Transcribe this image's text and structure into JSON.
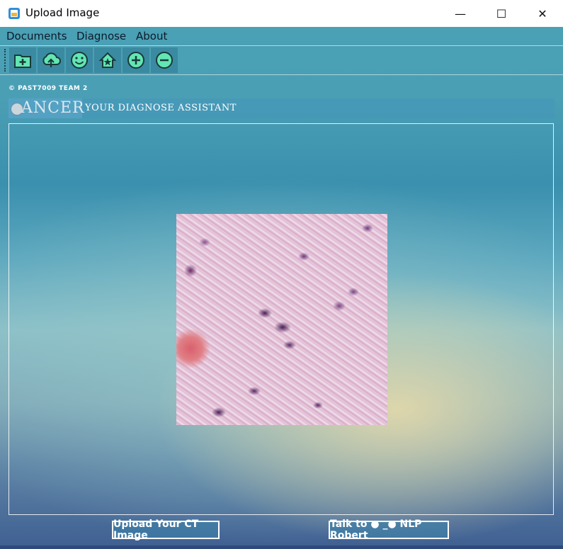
{
  "window": {
    "title": "Upload Image",
    "minimize_glyph": "—",
    "maximize_glyph": "☐",
    "close_glyph": "✕"
  },
  "menu": [
    "Documents",
    "Diagnose",
    "About"
  ],
  "toolbar": {
    "buttons": [
      {
        "name": "new-folder-icon",
        "color": "#1a3a3a",
        "fill": "#63e6b3"
      },
      {
        "name": "upload-cloud-icon",
        "color": "#1a3a3a",
        "fill": "#63e6b3"
      },
      {
        "name": "smiley-icon",
        "color": "#1a3a3a",
        "fill": "#63e6b3"
      },
      {
        "name": "home-star-icon",
        "color": "#1a3a3a",
        "fill": "#63e6b3"
      },
      {
        "name": "zoom-in-icon",
        "color": "#1a3a3a",
        "fill": "#63e6b3"
      },
      {
        "name": "zoom-out-icon",
        "color": "#1a3a3a",
        "fill": "#63e6b3"
      }
    ]
  },
  "header": {
    "copyright": "© PAST7009 TEAM 2",
    "logo": "ANCER",
    "tagline": "YOUR DIAGNOSE ASSISTANT"
  },
  "image": {
    "description_alt": "H&E histology tile"
  },
  "buttons": {
    "upload_label": "Upload Your CT Image",
    "talk_label": "Talk to ● _● NLP Robert"
  },
  "colors": {
    "accent_green": "#63e6b3",
    "panel_blue": "#4aa0b5"
  }
}
